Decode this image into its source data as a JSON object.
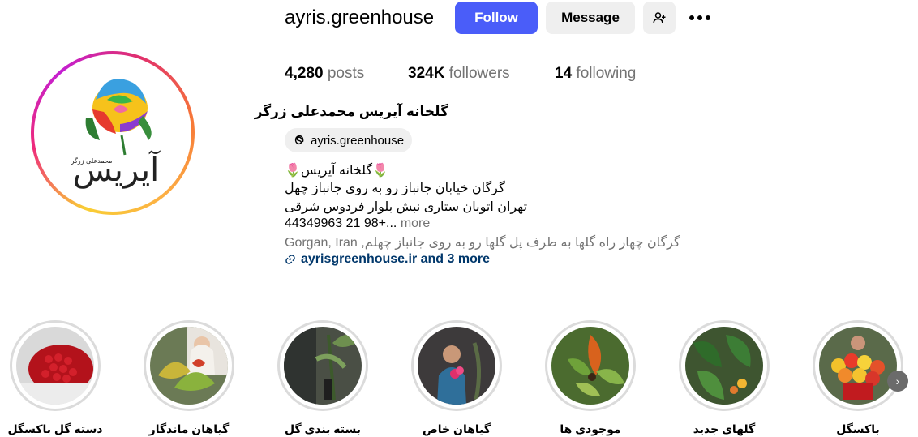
{
  "profile": {
    "username": "ayris.greenhouse",
    "follow_label": "Follow",
    "message_label": "Message",
    "posts_count": "4,280",
    "posts_label": "posts",
    "followers_count": "324K",
    "followers_label": "followers",
    "following_count": "14",
    "following_label": "following",
    "full_name": "گلخانه آیریس محمدعلی زرگر",
    "threads_handle": "ayris.greenhouse",
    "bio_line1": "🌷گلخانه آیریس🌷",
    "bio_line2": "گرگان خیابان جانباز رو به روی جانباز چهل",
    "bio_line3": "تهران اتوبان ستاری نبش بلوار فردوس شرقی",
    "bio_line4": "44349963 21 98+...",
    "more_label": "more",
    "location": "Gorgan, Iran ,گرگان چهار راه گلها به طرف پل گلها رو به روی جانباز چهلم",
    "link_text": "ayrisgreenhouse.ir and 3 more",
    "avatar_text": "آیریس",
    "avatar_small_text": "محمدعلی زرگر"
  },
  "highlights": [
    {
      "label": "دسته گل باکسگل"
    },
    {
      "label": "گیاهان ماندگار"
    },
    {
      "label": "بسته بندی گل"
    },
    {
      "label": "گیاهان خاص"
    },
    {
      "label": "موجودی ها"
    },
    {
      "label": "گلهای جدید"
    },
    {
      "label": "باکسگل"
    }
  ],
  "colors": {
    "follow_bg": "#4a5df9",
    "link": "#00376b",
    "muted": "#737373"
  },
  "icons": {
    "add_user": "person-plus-icon",
    "more": "ellipsis-icon",
    "threads": "threads-icon",
    "link": "link-icon",
    "scroll": "chevron-right-icon"
  }
}
